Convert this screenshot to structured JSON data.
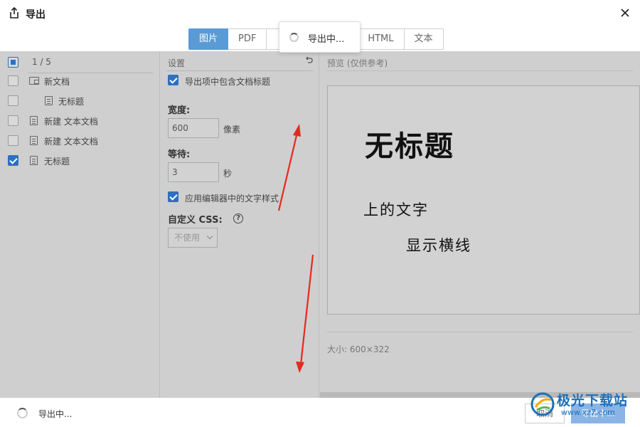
{
  "dialog": {
    "title": "导出",
    "close_icon": "close-icon",
    "export_icon": "share-export-icon"
  },
  "tabs": [
    {
      "label": "图片",
      "active": true
    },
    {
      "label": "PDF",
      "active": false
    },
    {
      "label": "HTML",
      "active": false
    },
    {
      "label": "文本",
      "active": false
    }
  ],
  "loading_toast": {
    "text": "导出中..."
  },
  "file_list": {
    "count": "1 / 5",
    "items": [
      {
        "label": "新文档",
        "icon": "folder-doc-icon",
        "checked": false,
        "indent": 0
      },
      {
        "label": "无标题",
        "icon": "document-icon",
        "checked": false,
        "indent": 1
      },
      {
        "label": "新建 文本文档",
        "icon": "document-icon",
        "checked": false,
        "indent": 0
      },
      {
        "label": "新建 文本文档",
        "icon": "document-icon",
        "checked": false,
        "indent": 0
      },
      {
        "label": "无标题",
        "icon": "document-icon",
        "checked": true,
        "indent": 0
      }
    ]
  },
  "settings": {
    "header": "设置",
    "include_title": {
      "label": "导出项中包含文档标题",
      "checked": true
    },
    "width": {
      "label": "宽度:",
      "value": "600",
      "unit": "像素"
    },
    "wait": {
      "label": "等待:",
      "value": "3",
      "unit": "秒"
    },
    "apply_styles": {
      "label": "应用编辑器中的文字样式",
      "checked": true
    },
    "custom_css": {
      "label": "自定义 CSS:",
      "help": "?",
      "select_value": "不使用"
    }
  },
  "preview": {
    "header": "预览 (仅供参考)",
    "title": "无标题",
    "line1": "上的文字",
    "line2": "显示横线",
    "size": "大小: 600×322"
  },
  "footer": {
    "status": "导出中...",
    "cancel": "取消",
    "export": "导出中..."
  },
  "watermark": {
    "text": "极光下载站",
    "url": "www.xz7.com"
  },
  "colors": {
    "accent": "#5b9bd5",
    "arrow": "#e8281f",
    "overlay": "#cfcfcf"
  }
}
